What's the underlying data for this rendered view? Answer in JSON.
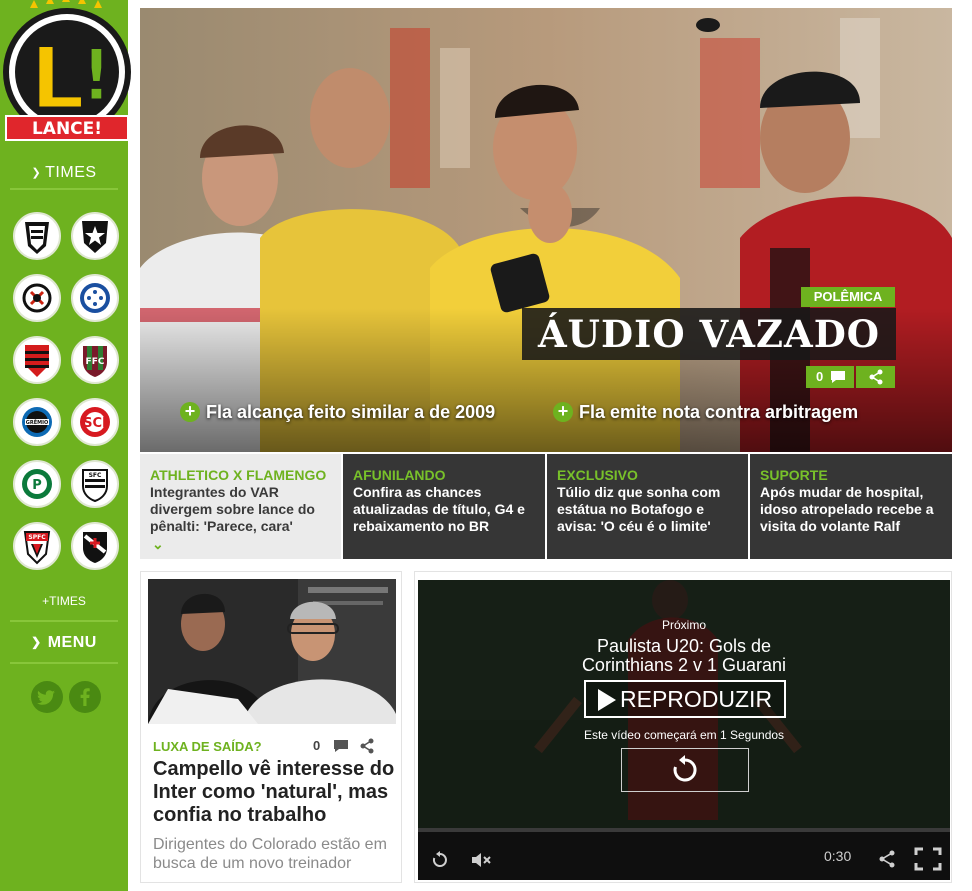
{
  "brand": {
    "logo_letter": "L!",
    "logo_word": "LANCE!",
    "green": "#6eb21f",
    "dark_tile": "#363636"
  },
  "sidebar": {
    "times_label": "TIMES",
    "clubs": [
      {
        "name": "Atlético-MG",
        "icon": "atletico-mg-crest-icon"
      },
      {
        "name": "Botafogo",
        "icon": "botafogo-crest-icon"
      },
      {
        "name": "Corinthians",
        "icon": "corinthians-crest-icon"
      },
      {
        "name": "Cruzeiro",
        "icon": "cruzeiro-crest-icon"
      },
      {
        "name": "Flamengo",
        "icon": "flamengo-crest-icon"
      },
      {
        "name": "Fluminense",
        "icon": "fluminense-crest-icon"
      },
      {
        "name": "Grêmio",
        "icon": "gremio-crest-icon"
      },
      {
        "name": "Internacional",
        "icon": "internacional-crest-icon"
      },
      {
        "name": "Palmeiras",
        "icon": "palmeiras-crest-icon"
      },
      {
        "name": "Santos",
        "icon": "santos-crest-icon"
      },
      {
        "name": "São Paulo",
        "icon": "sao-paulo-crest-icon"
      },
      {
        "name": "Vasco",
        "icon": "vasco-crest-icon"
      }
    ],
    "more_times": "+TIMES",
    "menu_label": "MENU",
    "social": [
      "twitter-icon",
      "facebook-icon"
    ]
  },
  "hero": {
    "tag": "POLÊMICA",
    "title": "ÁUDIO VAZADO",
    "comment_count": "0",
    "links": [
      "Fla alcança feito similar a de 2009",
      "Fla emite nota contra arbitragem"
    ]
  },
  "tiles": [
    {
      "kicker": "ATHLETICO X FLAMENGO",
      "text": "Integrantes do VAR divergem sobre lance do pênalti: 'Parece, cara'"
    },
    {
      "kicker": "AFUNILANDO",
      "text": "Confira as chances atualizadas de título, G4 e rebaixamento no BR"
    },
    {
      "kicker": "EXCLUSIVO",
      "text": "Túlio diz que sonha com estátua no Botafogo e avisa: 'O céu é o limite'"
    },
    {
      "kicker": "SUPORTE",
      "text": "Após mudar de hospital, idoso atropelado recebe a visita do volante Ralf"
    }
  ],
  "card": {
    "kicker": "LUXA DE SAÍDA?",
    "comment_count": "0",
    "headline": "Campello vê interesse do Inter como 'natural', mas confia no trabalho",
    "subtitle": "Dirigentes do Colorado estão em busca de um novo treinador"
  },
  "player": {
    "next_label": "Próximo",
    "next_title": "Paulista U20: Gols de Corinthians 2 v 1 Guarani",
    "play_label": "REPRODUZIR",
    "countdown": "Este vídeo começará em 1 Segundos",
    "time": "0:30"
  }
}
